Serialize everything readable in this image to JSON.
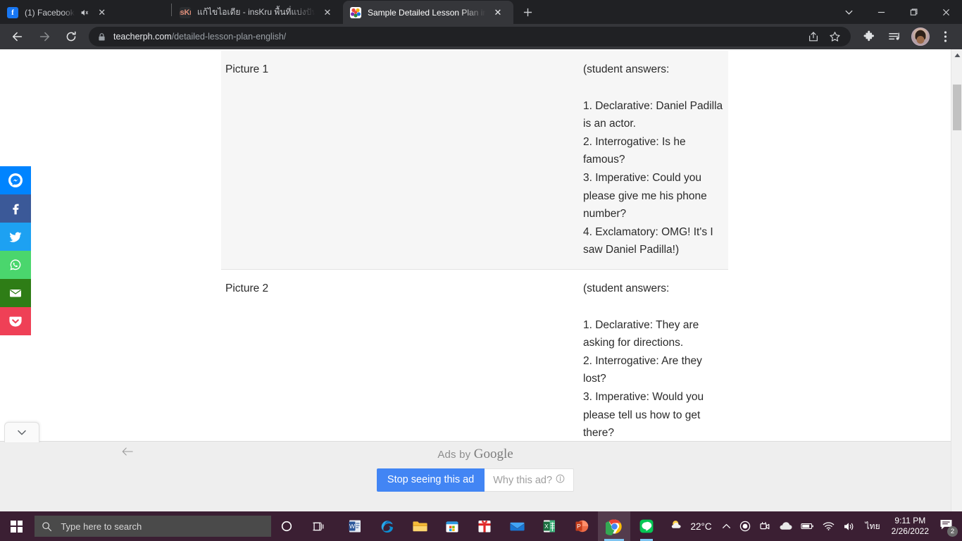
{
  "browser": {
    "tabs": [
      {
        "title": "(1) Facebook",
        "favicon": "facebook-icon",
        "active": false,
        "muted": true
      },
      {
        "title": "แก้ไขไอเดีย - insKru พื้นที่แบ่งปันไอเดี",
        "favicon": "inskru-icon",
        "active": false,
        "muted": false
      },
      {
        "title": "Sample Detailed Lesson Plan in E",
        "favicon": "teacherph-icon",
        "active": true,
        "muted": false
      }
    ],
    "new_tab_label": "+",
    "window_controls": {
      "tab_search": "tab-search-chevron",
      "minimize": "–",
      "maximize": "maximize",
      "close": "✕"
    },
    "toolbar": {
      "back": "back-arrow",
      "forward": "forward-arrow",
      "reload": "reload-arrow",
      "url_domain": "teacherph.com",
      "url_path": "/detailed-lesson-plan-english/",
      "url_full": "teacherph.com/detailed-lesson-plan-english/",
      "share_icon": "share-icon",
      "bookmark_icon": "star-icon",
      "extensions_icon": "puzzle-icon",
      "media_icon": "media-playlist-icon",
      "profile_icon": "profile-avatar",
      "menu_icon": "three-dot-menu-icon"
    }
  },
  "social_rail": [
    {
      "name": "messenger",
      "label": "Messenger",
      "color": "#0084ff"
    },
    {
      "name": "facebook",
      "label": "Facebook",
      "color": "#3b5998"
    },
    {
      "name": "twitter",
      "label": "Twitter",
      "color": "#1da1f2"
    },
    {
      "name": "whatsapp",
      "label": "WhatsApp",
      "color": "#4ad66d"
    },
    {
      "name": "email",
      "label": "Email",
      "color": "#2e7d16"
    },
    {
      "name": "pocket",
      "label": "Pocket",
      "color": "#ef4056"
    }
  ],
  "page": {
    "table_rows": [
      {
        "left": "Picture 1",
        "answers_header": "(student answers:",
        "answers": [
          "1. Declarative: Daniel Padilla is an actor.",
          "2. Interrogative: Is he famous?",
          "3. Imperative: Could you please give me his phone number?",
          "4. Exclamatory: OMG! It's I saw Daniel Padilla!)"
        ],
        "shaded": true
      },
      {
        "left": "Picture 2",
        "answers_header": "(student answers:",
        "answers": [
          "1. Declarative: They are asking for directions.",
          "2. Interrogative: Are they lost?",
          "3. Imperative: Would you please tell us how to get there?"
        ],
        "shaded": false
      }
    ]
  },
  "ad": {
    "collapse_icon": "chevron-down-icon",
    "back_icon": "left-arrow-icon",
    "ads_by_text": "Ads by",
    "ads_by_brand": "Google",
    "stop_button": "Stop seeing this ad",
    "why_button": "Why this ad?",
    "why_info_icon": "info-icon"
  },
  "taskbar": {
    "start": "windows-logo",
    "search_placeholder": "Type here to search",
    "search_icon": "search-icon",
    "cortana_icon": "cortana-circle-icon",
    "taskview_icon": "task-view-icon",
    "apps": [
      {
        "name": "word",
        "label": "Word",
        "color": "#2b579a"
      },
      {
        "name": "edge",
        "label": "Microsoft Edge",
        "color": "#0c8fd4"
      },
      {
        "name": "file-explorer",
        "label": "File Explorer",
        "color": "#ffc107"
      },
      {
        "name": "microsoft-store",
        "label": "Microsoft Store",
        "color": "#ffffff"
      },
      {
        "name": "rewards-gift",
        "label": "Gift",
        "color": "#e02a2a"
      },
      {
        "name": "mail",
        "label": "Mail",
        "color": "#2196f3"
      },
      {
        "name": "excel",
        "label": "Excel",
        "color": "#1d6f42"
      },
      {
        "name": "powerpoint",
        "label": "PowerPoint",
        "color": "#d24726"
      },
      {
        "name": "chrome",
        "label": "Google Chrome",
        "color": "#4285f4"
      },
      {
        "name": "line",
        "label": "LINE",
        "color": "#06c755"
      }
    ],
    "tray": {
      "weather_icon": "partly-cloudy-icon",
      "temperature": "22°C",
      "chevron_up": "show-hidden-icons",
      "record_icon": "record-icon",
      "camera_icon": "camera-icon",
      "onedrive_icon": "onedrive-cloud-icon",
      "battery_icon": "battery-icon",
      "wifi_icon": "wifi-icon",
      "volume_icon": "volume-icon",
      "language": "ไทย",
      "time": "9:11 PM",
      "date": "2/26/2022",
      "notification_icon": "notification-icon",
      "notification_count": "2"
    }
  }
}
